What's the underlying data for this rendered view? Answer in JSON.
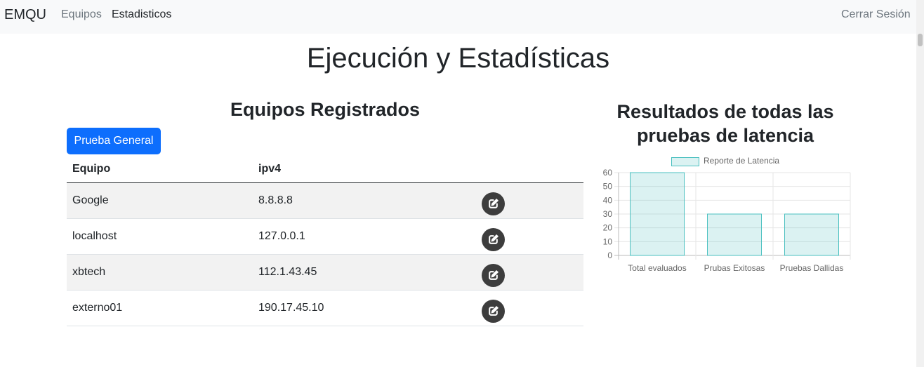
{
  "navbar": {
    "brand": "EMQU",
    "links": [
      "Equipos",
      "Estadisticos"
    ],
    "logout": "Cerrar Sesión"
  },
  "page": {
    "title": "Ejecución y Estadísticas"
  },
  "devices": {
    "heading": "Equipos Registrados",
    "button_label": "Prueba General",
    "columns": [
      "Equipo",
      "ipv4"
    ],
    "rows": [
      {
        "name": "Google",
        "ipv4": "8.8.8.8"
      },
      {
        "name": "localhost",
        "ipv4": "127.0.0.1"
      },
      {
        "name": "xbtech",
        "ipv4": "112.1.43.45"
      },
      {
        "name": "externo01",
        "ipv4": "190.17.45.10"
      }
    ],
    "edit_icon": "edit-icon"
  },
  "stats": {
    "heading": "Resultados de todas las pruebas de latencia"
  },
  "chart_data": {
    "type": "bar",
    "categories": [
      "Total evaluados",
      "Prubas Exitosas",
      "Pruebas Dallidas"
    ],
    "series": [
      {
        "name": "Reporte de Latencia",
        "values": [
          60,
          30,
          30
        ]
      }
    ],
    "ylim": [
      0,
      60
    ],
    "yticks": [
      0,
      10,
      20,
      30,
      40,
      50,
      60
    ],
    "grid": true,
    "legend": "top",
    "colors": {
      "fill": "rgba(75,192,192,0.2)",
      "stroke": "#4bc0c0"
    }
  }
}
